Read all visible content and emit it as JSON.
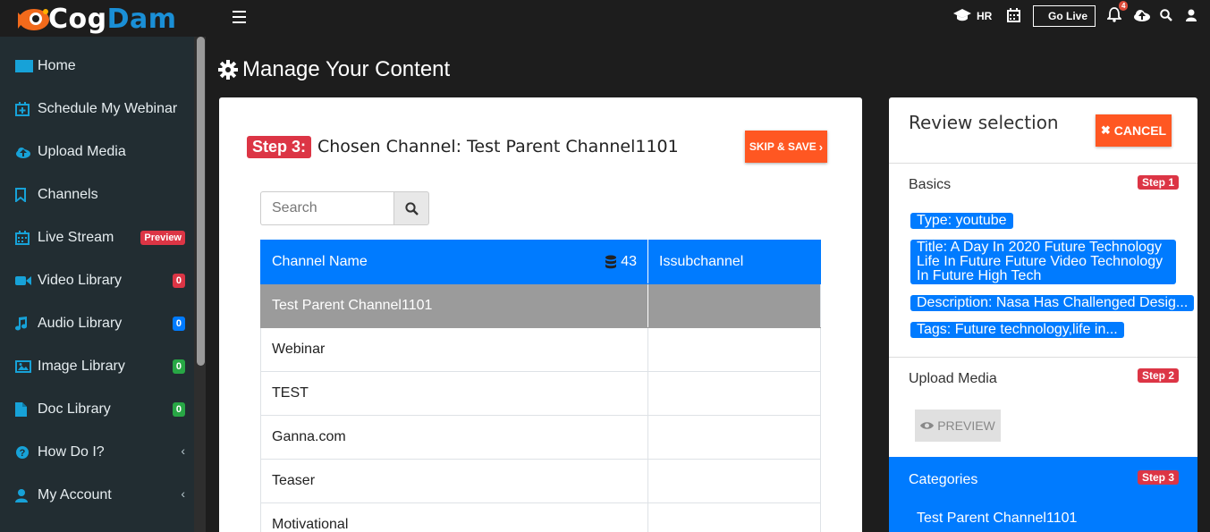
{
  "brand": {
    "name_part1": "Cog",
    "name_part2": "Dam"
  },
  "sidebar": {
    "items": [
      {
        "label": "Home",
        "icon": "monitor-icon"
      },
      {
        "label": "Schedule My Webinar",
        "icon": "calendar-plus-icon"
      },
      {
        "label": "Upload Media",
        "icon": "cloud-upload-icon"
      },
      {
        "label": "Channels",
        "icon": "bookmark-icon"
      },
      {
        "label": "Live Stream",
        "icon": "calendar-icon",
        "badge": "Preview"
      },
      {
        "label": "Video Library",
        "icon": "video-camera-icon",
        "badge": "0"
      },
      {
        "label": "Audio Library",
        "icon": "music-note-icon",
        "badge": "0"
      },
      {
        "label": "Image Library",
        "icon": "image-icon",
        "badge": "0"
      },
      {
        "label": "Doc Library",
        "icon": "file-icon",
        "badge": "0"
      },
      {
        "label": "How Do I?",
        "icon": "question-circle-icon"
      },
      {
        "label": "My Account",
        "icon": "user-icon"
      }
    ]
  },
  "topbar": {
    "hr_label": "HR",
    "golive_label": "Go Live",
    "notification_count": "4"
  },
  "page": {
    "title": "Manage Your Content"
  },
  "main": {
    "step_label": "Step 3:",
    "chosen_text": "Chosen Channel: Test Parent Channel1101",
    "skip_label": "SKIP & SAVE",
    "search_placeholder": "Search",
    "table": {
      "col_channel": "Channel Name",
      "col_count": "43",
      "col_sub": "Issubchannel",
      "rows": [
        "Test Parent Channel1101",
        "Webinar",
        "TEST",
        "Ganna.com",
        "Teaser",
        "Motivational"
      ]
    }
  },
  "review": {
    "title": "Review selection",
    "cancel_label": "CANCEL",
    "basics": {
      "title": "Basics",
      "step": "Step 1",
      "type": "Type: youtube",
      "title_line1": "Title: A Day In 2020 Future Technology",
      "title_line2": "Life In Future Future Video Technology",
      "title_line3": "In Future High Tech",
      "description": "Description: Nasa Has Challenged Desig...",
      "tags": "Tags: Future technology,life in..."
    },
    "upload": {
      "title": "Upload Media",
      "step": "Step 2",
      "preview_label": "PREVIEW"
    },
    "categories": {
      "title": "Categories",
      "step": "Step 3",
      "value": "Test Parent Channel1101"
    }
  },
  "colors": {
    "primary": "#007bff",
    "danger": "#dc3545",
    "orange": "#ff5722",
    "sidebar": "#222d32"
  }
}
